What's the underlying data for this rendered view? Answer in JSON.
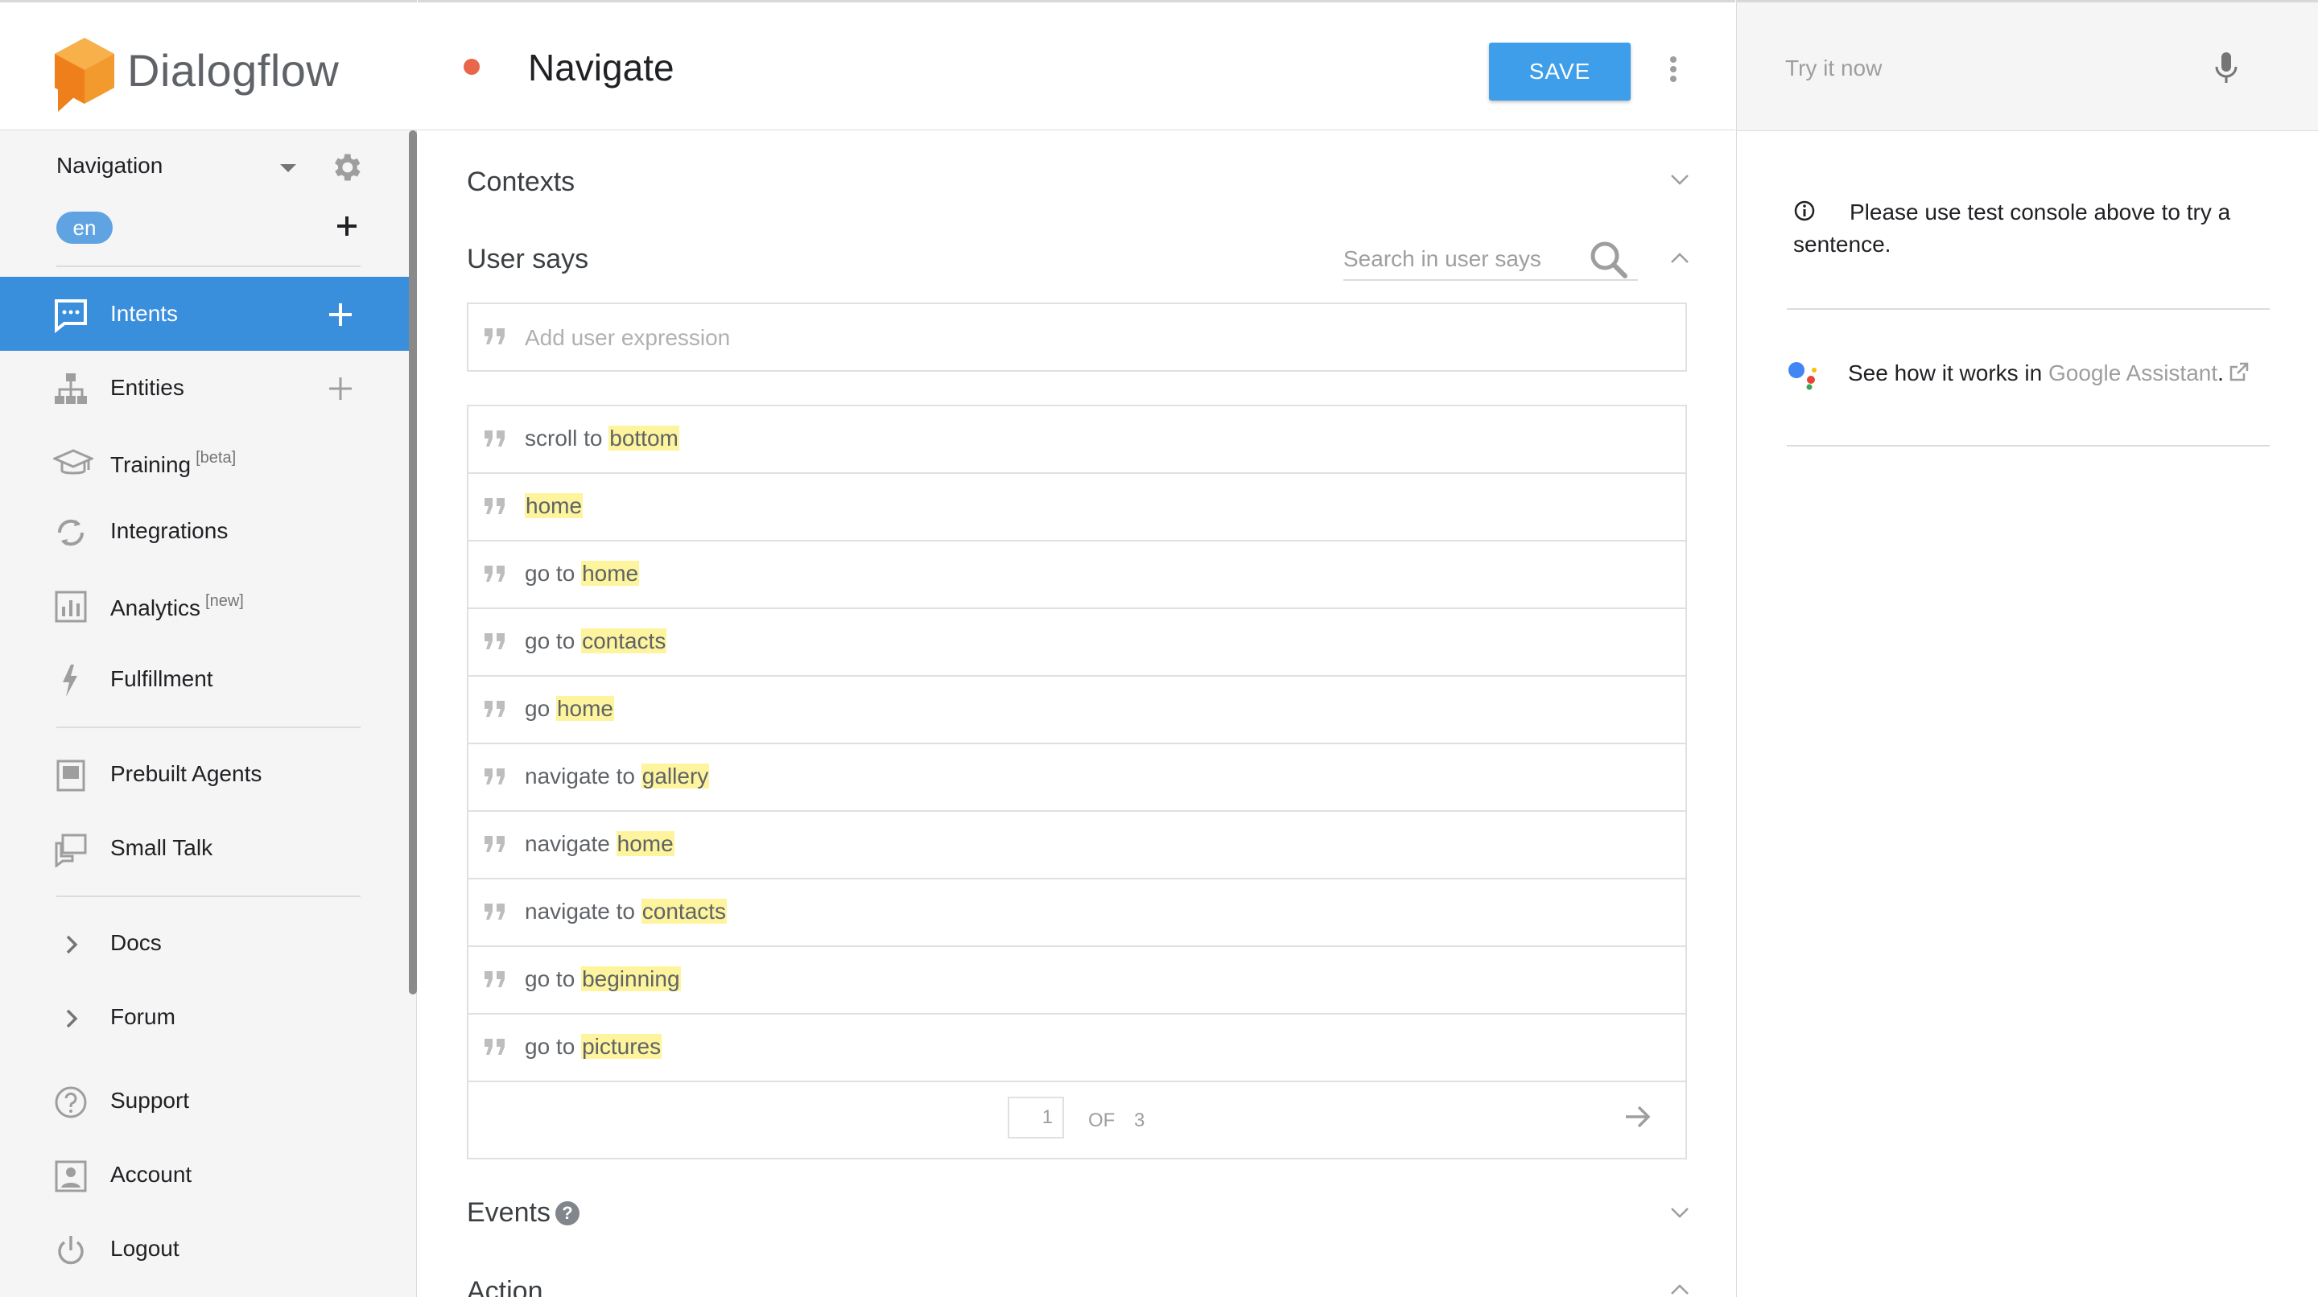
{
  "brand": {
    "name": "Dialogflow"
  },
  "agent": {
    "name": "Navigation",
    "language": "en"
  },
  "nav": {
    "primary": [
      {
        "label": "Intents",
        "sup": "",
        "icon": "chat-icon",
        "has_add": true,
        "active": true
      },
      {
        "label": "Entities",
        "sup": "",
        "icon": "hierarchy-icon",
        "has_add": true,
        "active": false
      },
      {
        "label": "Training",
        "sup": "[beta]",
        "icon": "graduation-cap-icon",
        "has_add": false,
        "active": false
      },
      {
        "label": "Integrations",
        "sup": "",
        "icon": "sync-icon",
        "has_add": false,
        "active": false
      },
      {
        "label": "Analytics",
        "sup": "[new]",
        "icon": "bar-chart-icon",
        "has_add": false,
        "active": false
      },
      {
        "label": "Fulfillment",
        "sup": "",
        "icon": "lightning-icon",
        "has_add": false,
        "active": false
      }
    ],
    "secondary": [
      {
        "label": "Prebuilt Agents",
        "icon": "book-icon"
      },
      {
        "label": "Small Talk",
        "icon": "chat-bubbles-icon"
      }
    ],
    "links": [
      {
        "label": "Docs",
        "icon": "chevron-right-icon"
      },
      {
        "label": "Forum",
        "icon": "chevron-right-icon"
      }
    ],
    "account": [
      {
        "label": "Support",
        "icon": "question-circle-icon"
      },
      {
        "label": "Account",
        "icon": "account-icon"
      },
      {
        "label": "Logout",
        "icon": "power-icon"
      }
    ]
  },
  "header": {
    "intent_title": "Navigate",
    "save_label": "SAVE",
    "status_color": "#e8674a"
  },
  "sections": {
    "contexts": "Contexts",
    "user_says": "User says",
    "events": "Events",
    "action": "Action"
  },
  "search": {
    "placeholder": "Search in user says"
  },
  "add_expression": {
    "placeholder": "Add user expression"
  },
  "expressions": [
    {
      "prefix": "scroll to ",
      "highlight": "bottom"
    },
    {
      "prefix": "",
      "highlight": "home"
    },
    {
      "prefix": "go to ",
      "highlight": "home"
    },
    {
      "prefix": "go to ",
      "highlight": "contacts"
    },
    {
      "prefix": "go ",
      "highlight": "home"
    },
    {
      "prefix": "navigate to ",
      "highlight": "gallery"
    },
    {
      "prefix": "navigate ",
      "highlight": "home"
    },
    {
      "prefix": "navigate to ",
      "highlight": "contacts"
    },
    {
      "prefix": "go to ",
      "highlight": "beginning"
    },
    {
      "prefix": "go to ",
      "highlight": "pictures"
    }
  ],
  "pagination": {
    "current": "1",
    "of_label": "OF",
    "total": "3"
  },
  "right_panel": {
    "try_placeholder": "Try it now",
    "info_text": "Please use test console above to try a sentence.",
    "ga_prefix": "See how it works in ",
    "ga_link": "Google Assistant",
    "ga_suffix": "."
  },
  "colors": {
    "accent": "#3a8fdc",
    "save": "#3e9ee9",
    "highlight": "#fdf49d",
    "lang_pill": "#5fa3e2"
  }
}
